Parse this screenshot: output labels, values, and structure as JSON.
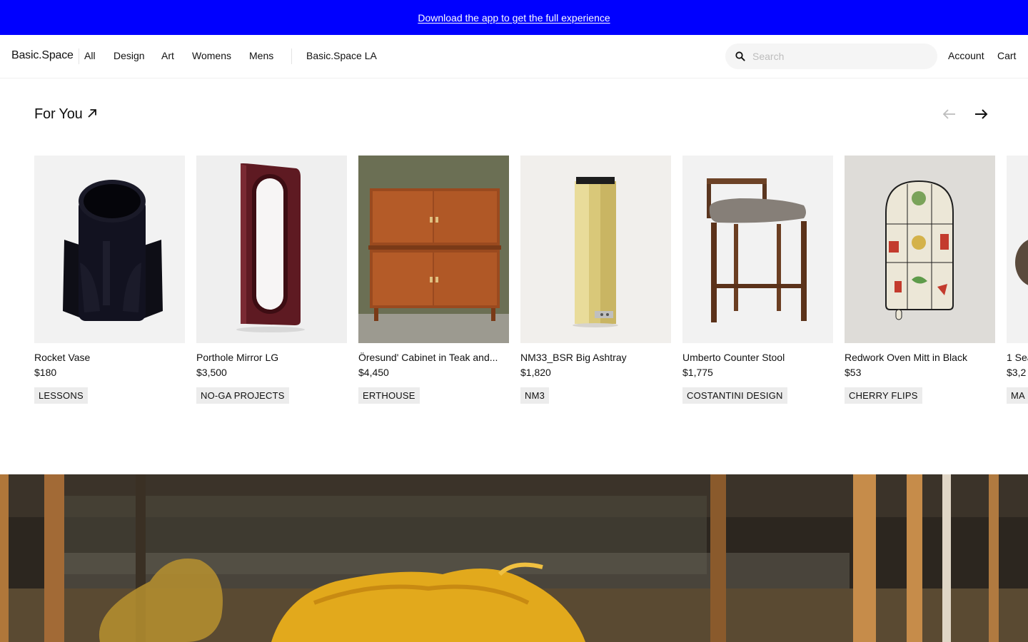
{
  "banner": {
    "text": "Download the app to get the full experience",
    "bg_color": "#0000ff"
  },
  "nav": {
    "brand": "Basic.Space",
    "links": [
      "All",
      "Design",
      "Art",
      "Womens",
      "Mens"
    ],
    "location_link": "Basic.Space LA",
    "search_placeholder": "Search",
    "search_icon": "search-icon",
    "account": "Account",
    "cart": "Cart"
  },
  "for_you": {
    "title": "For You",
    "title_icon": "arrow-up-right-icon",
    "prev_icon": "arrow-left-icon",
    "next_icon": "arrow-right-icon",
    "products": [
      {
        "name": "Rocket Vase",
        "price": "$180",
        "brand": "LESSONS"
      },
      {
        "name": "Porthole Mirror LG",
        "price": "$3,500",
        "brand": "NO-GA PROJECTS"
      },
      {
        "name": "Öresund' Cabinet in Teak and...",
        "price": "$4,450",
        "brand": "ERTHOUSE"
      },
      {
        "name": "NM33_BSR Big Ashtray",
        "price": "$1,820",
        "brand": "NM3"
      },
      {
        "name": "Umberto Counter Stool",
        "price": "$1,775",
        "brand": "COSTANTINI DESIGN"
      },
      {
        "name": "Redwork Oven Mitt in Black",
        "price": "$53",
        "brand": "CHERRY FLIPS"
      },
      {
        "name": "1 Sea",
        "price": "$3,2",
        "brand": "MA"
      }
    ]
  }
}
